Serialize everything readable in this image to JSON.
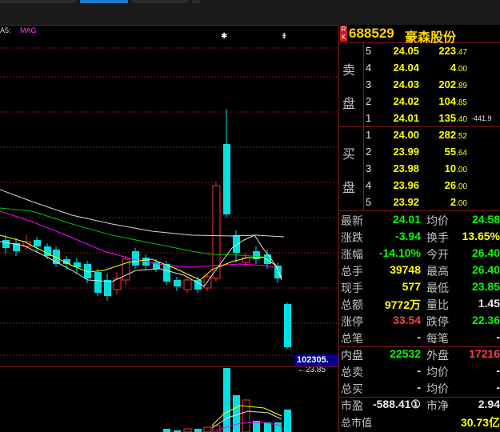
{
  "chart": {
    "ma5_label": "A5:",
    "mag_label": "MAG",
    "star1": "✱",
    "star2": "⇟",
    "low_marker": "←23.85",
    "volume_box": "102305."
  },
  "quote_header": {
    "badge": "R K",
    "code": "688529",
    "name": "豪森股份"
  },
  "order_book": {
    "sell_label_1": "卖",
    "sell_label_2": "盘",
    "buy_label_1": "买",
    "buy_label_2": "盘",
    "sell": [
      {
        "level": "5",
        "price": "24.05",
        "vol_main": "223",
        "vol_frac": ".47",
        "extra": ""
      },
      {
        "level": "4",
        "price": "24.04",
        "vol_main": "4",
        "vol_frac": ".00",
        "extra": ""
      },
      {
        "level": "3",
        "price": "24.03",
        "vol_main": "202",
        "vol_frac": ".89",
        "extra": ""
      },
      {
        "level": "2",
        "price": "24.02",
        "vol_main": "104",
        "vol_frac": ".85",
        "extra": ""
      },
      {
        "level": "1",
        "price": "24.01",
        "vol_main": "135",
        "vol_frac": ".40",
        "extra": "-441.9"
      }
    ],
    "buy": [
      {
        "level": "1",
        "price": "24.00",
        "vol_main": "282",
        "vol_frac": ".52"
      },
      {
        "level": "2",
        "price": "23.99",
        "vol_main": "55",
        "vol_frac": ".64"
      },
      {
        "level": "3",
        "price": "23.98",
        "vol_main": "10",
        "vol_frac": ".00"
      },
      {
        "level": "4",
        "price": "23.96",
        "vol_main": "26",
        "vol_frac": ".00"
      },
      {
        "level": "5",
        "price": "23.92",
        "vol_main": "2",
        "vol_frac": ".00"
      }
    ]
  },
  "stats": [
    {
      "l1": "最新",
      "v1": "24.01",
      "c1": "green",
      "l2": "均价",
      "v2": "24.58",
      "c2": "green"
    },
    {
      "l1": "涨跌",
      "v1": "-3.94",
      "c1": "green",
      "l2": "换手",
      "v2": "13.65%",
      "c2": "yellow"
    },
    {
      "l1": "涨幅",
      "v1": "-14.10%",
      "c1": "green",
      "l2": "今开",
      "v2": "26.40",
      "c2": "green"
    },
    {
      "l1": "总手",
      "v1": "39748",
      "c1": "yellow",
      "l2": "最高",
      "v2": "26.40",
      "c2": "green"
    },
    {
      "l1": "现手",
      "v1": "577",
      "c1": "yellow",
      "l2": "最低",
      "v2": "23.85",
      "c2": "green"
    },
    {
      "l1": "总额",
      "v1": "9772万",
      "c1": "yellow",
      "l2": "量比",
      "v2": "1.45",
      "c2": "white"
    },
    {
      "l1": "涨停",
      "v1": "33.54",
      "c1": "red",
      "l2": "跌停",
      "v2": "22.36",
      "c2": "green"
    },
    {
      "l1": "总笔",
      "v1": "-",
      "c1": "white",
      "l2": "每笔",
      "v2": "-",
      "c2": "white"
    },
    {
      "l1": "内盘",
      "v1": "22532",
      "c1": "green",
      "l2": "外盘",
      "v2": "17216",
      "c2": "red"
    },
    {
      "l1": "总卖",
      "v1": "-",
      "c1": "white",
      "l2": "均价",
      "v2": "-",
      "c2": "white"
    },
    {
      "l1": "总买",
      "v1": "-",
      "c1": "white",
      "l2": "均价",
      "v2": "-",
      "c2": "white"
    },
    {
      "l1": "市盈",
      "v1": "-588.41①",
      "c1": "white",
      "l2": "市净",
      "v2": "2.94",
      "c2": "white"
    },
    {
      "l1": "总市值",
      "v1": "",
      "c1": "white",
      "l2": "",
      "v2": "30.73亿",
      "c2": "yellow"
    }
  ],
  "colors": {
    "up": "#ff3030",
    "down": "#00e0e0",
    "grid": "#7a1818",
    "ma_white": "#d8d8d8",
    "ma_yellow": "#ffff00",
    "ma_magenta": "#ff00ff",
    "ma_green": "#00c000"
  }
}
